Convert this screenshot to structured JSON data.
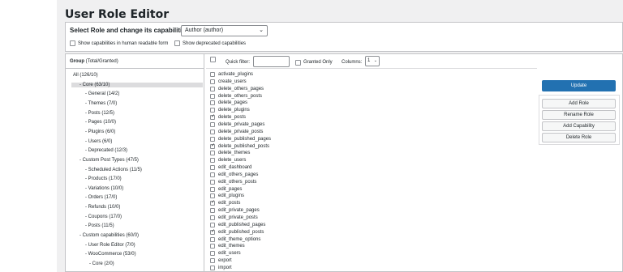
{
  "page": {
    "title": "User Role Editor"
  },
  "role_selector": {
    "label": "Select Role and change its capabilities:",
    "selected_role": "Author (author)",
    "show_human_readable_label": "Show capabilities in human readable form",
    "show_human_readable_checked": false,
    "show_deprecated_label": "Show deprecated capabilities",
    "show_deprecated_checked": false
  },
  "groups": {
    "header_title": "Group",
    "header_counts": "(Total/Granted)",
    "items": [
      {
        "label": "All (126/10)",
        "indent": 0,
        "selected": false
      },
      {
        "label": "- Core (63/10)",
        "indent": 1,
        "selected": true
      },
      {
        "label": "- General (14/2)",
        "indent": 2,
        "selected": false
      },
      {
        "label": "- Themes (7/0)",
        "indent": 2,
        "selected": false
      },
      {
        "label": "- Posts (12/5)",
        "indent": 2,
        "selected": false
      },
      {
        "label": "- Pages (10/0)",
        "indent": 2,
        "selected": false
      },
      {
        "label": "- Plugins (6/0)",
        "indent": 2,
        "selected": false
      },
      {
        "label": "- Users (6/0)",
        "indent": 2,
        "selected": false
      },
      {
        "label": "- Deprecated (12/3)",
        "indent": 2,
        "selected": false
      },
      {
        "label": "- Custom Post Types (47/5)",
        "indent": 1,
        "selected": false
      },
      {
        "label": "- Scheduled Actions (11/5)",
        "indent": 2,
        "selected": false
      },
      {
        "label": "- Products (17/0)",
        "indent": 2,
        "selected": false
      },
      {
        "label": "- Variations (10/0)",
        "indent": 2,
        "selected": false
      },
      {
        "label": "- Orders (17/0)",
        "indent": 2,
        "selected": false
      },
      {
        "label": "- Refunds (10/0)",
        "indent": 2,
        "selected": false
      },
      {
        "label": "- Coupons (17/0)",
        "indent": 2,
        "selected": false
      },
      {
        "label": "- Posts (11/5)",
        "indent": 2,
        "selected": false
      },
      {
        "label": "- Custom capabilities (60/0)",
        "indent": 1,
        "selected": false
      },
      {
        "label": "- User Role Editor (7/0)",
        "indent": 2,
        "selected": false
      },
      {
        "label": "- WooCommerce (53/0)",
        "indent": 2,
        "selected": false
      },
      {
        "label": "- Core (2/0)",
        "indent": 3,
        "selected": false
      }
    ]
  },
  "filters": {
    "quick_filter_label": "Quick filter:",
    "quick_filter_value": "",
    "granted_only_label": "Granted Only",
    "granted_only_checked": false,
    "columns_label": "Columns:",
    "columns_value": "1"
  },
  "capabilities": [
    {
      "name": "activate_plugins",
      "checked": false
    },
    {
      "name": "create_users",
      "checked": false
    },
    {
      "name": "delete_others_pages",
      "checked": false
    },
    {
      "name": "delete_others_posts",
      "checked": false
    },
    {
      "name": "delete_pages",
      "checked": false
    },
    {
      "name": "delete_plugins",
      "checked": false
    },
    {
      "name": "delete_posts",
      "checked": true
    },
    {
      "name": "delete_private_pages",
      "checked": false
    },
    {
      "name": "delete_private_posts",
      "checked": false
    },
    {
      "name": "delete_published_pages",
      "checked": false
    },
    {
      "name": "delete_published_posts",
      "checked": true
    },
    {
      "name": "delete_themes",
      "checked": false
    },
    {
      "name": "delete_users",
      "checked": false
    },
    {
      "name": "edit_dashboard",
      "checked": false
    },
    {
      "name": "edit_others_pages",
      "checked": false
    },
    {
      "name": "edit_others_posts",
      "checked": false
    },
    {
      "name": "edit_pages",
      "checked": false
    },
    {
      "name": "edit_plugins",
      "checked": false
    },
    {
      "name": "edit_posts",
      "checked": true
    },
    {
      "name": "edit_private_pages",
      "checked": false
    },
    {
      "name": "edit_private_posts",
      "checked": false
    },
    {
      "name": "edit_published_pages",
      "checked": false
    },
    {
      "name": "edit_published_posts",
      "checked": true
    },
    {
      "name": "edit_theme_options",
      "checked": false
    },
    {
      "name": "edit_themes",
      "checked": false
    },
    {
      "name": "edit_users",
      "checked": false
    },
    {
      "name": "export",
      "checked": false
    },
    {
      "name": "import",
      "checked": false
    }
  ],
  "actions": {
    "update": "Update",
    "add_role": "Add Role",
    "rename_role": "Rename Role",
    "add_capability": "Add Capability",
    "delete_role": "Delete Role"
  },
  "colors": {
    "primary_button": "#2271b1",
    "selected_group_bg": "#dcdcde",
    "page_bg": "#f0f0f1"
  }
}
